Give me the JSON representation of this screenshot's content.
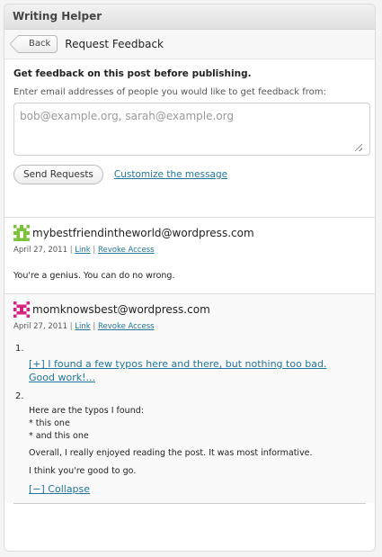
{
  "panel": {
    "title": "Writing Helper"
  },
  "nav": {
    "back_label": "Back",
    "title": "Request Feedback"
  },
  "form": {
    "heading": "Get feedback on this post before publishing.",
    "description": "Enter email addresses of people you would like to get feedback from:",
    "email_placeholder": "bob@example.org, sarah@example.org",
    "email_value": "",
    "send_label": "Send Requests",
    "customize_label": "Customize the message"
  },
  "feedback": [
    {
      "email": "mybestfriendintheworld@wordpress.com",
      "date": "April 27, 2011",
      "link_label": "Link",
      "revoke_label": "Revoke Access",
      "comment": "You're a genius. You can do no wrong.",
      "avatar_color": "#7cc33b"
    },
    {
      "email": "momknowsbest@wordpress.com",
      "date": "April 27, 2011",
      "link_label": "Link",
      "revoke_label": "Revoke Access",
      "avatar_color": "#d6237e",
      "notes": [
        {
          "number": "1.",
          "expand_label": "[+] I found a few typos here and there, but nothing too bad. Good work!..."
        },
        {
          "number": "2.",
          "intro": "Here are the typos I found:",
          "typos": [
            "* this one",
            "* and this one"
          ],
          "para1": "Overall, I really enjoyed reading the post. It was most informative.",
          "para2": "I think you're good to go.",
          "collapse_label": "[−] Collapse"
        }
      ]
    }
  ]
}
